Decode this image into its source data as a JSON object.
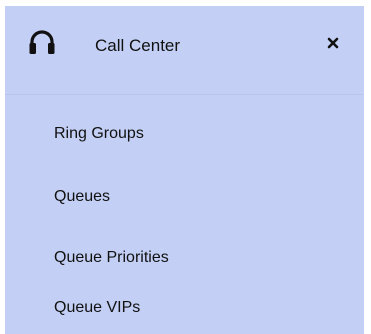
{
  "panel": {
    "title": "Call Center",
    "title_icon": "headset-icon",
    "close_icon": "close-icon",
    "close_glyph": "×",
    "background_color": "#c3cff4"
  },
  "menu": {
    "items": [
      {
        "label": "Ring Groups"
      },
      {
        "label": "Queues"
      },
      {
        "label": "Queue Priorities"
      },
      {
        "label": "Queue VIPs"
      }
    ]
  }
}
